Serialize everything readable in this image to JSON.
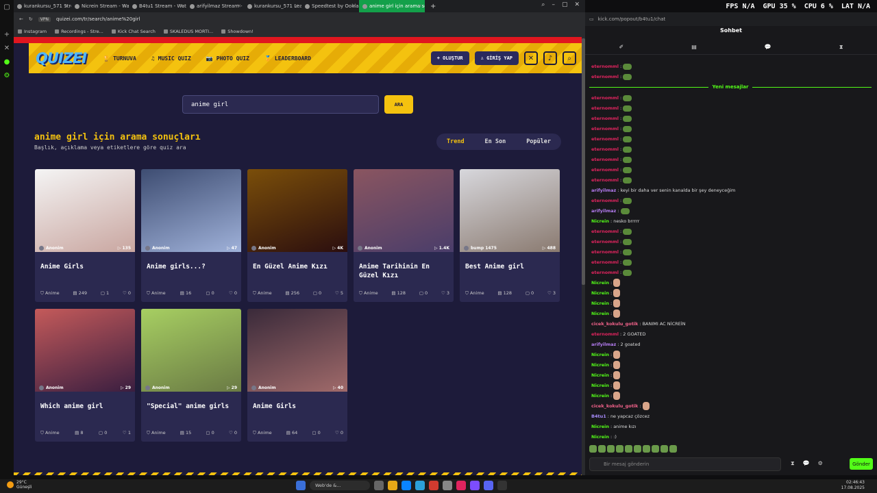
{
  "browser": {
    "tabs": [
      {
        "title": "kurankursu_571 Strea"
      },
      {
        "title": "Nicrein Stream - Watch L"
      },
      {
        "title": "B4tu1 Stream - Watch Liv"
      },
      {
        "title": "arifyilmaz Stream - Watc"
      },
      {
        "title": "kurankursu_571 Leaderb"
      },
      {
        "title": "Speedtest by Ookla - The"
      },
      {
        "title": "anime girl için arama son"
      }
    ],
    "new_tab": "+",
    "url_badge": "VPN",
    "url": "quizei.com/tr/search/anime%20girl",
    "bookmarks": [
      "Instagram",
      "Recordings - Stre...",
      "Kick Chat Search",
      "SKALEDUS MORTI...",
      "Showdown!"
    ]
  },
  "site": {
    "logo": "QUIZEI",
    "nav": [
      {
        "icon": "trophy-icon",
        "glyph": "🏆",
        "label": "TURNUVA"
      },
      {
        "icon": "music-note-icon",
        "glyph": "♫",
        "label": "MUSIC QUIZ"
      },
      {
        "icon": "camera-icon",
        "glyph": "📷",
        "label": "PHOTO QUIZ"
      },
      {
        "icon": "leaderboard-icon",
        "glyph": "🏅",
        "label": "LEADERBOARD"
      }
    ],
    "create_label": "+ OLUŞTUR",
    "login_label": "♙ GİRİŞ YAP",
    "search": {
      "value": "anime girl",
      "button": "ARA"
    },
    "results_title": "anime girl için arama sonuçları",
    "results_subtitle": "Başlık, açıklama veya etiketlere göre quiz ara",
    "sort_tabs": [
      {
        "label": "Trend",
        "active": true
      },
      {
        "label": "En Son"
      },
      {
        "label": "Popüler"
      }
    ],
    "cards": [
      {
        "author": "Anonim",
        "plays": "▷ 135",
        "title": "Anime Girls",
        "category": "Anime",
        "items": "249",
        "comments": "1",
        "likes": "0",
        "thumb_colors": [
          "#f4f4f4",
          "#c9a6a0"
        ]
      },
      {
        "author": "Anonim",
        "plays": "▷ 47",
        "title": "Anime girls...?",
        "category": "Anime",
        "items": "16",
        "comments": "0",
        "likes": "0",
        "thumb_colors": [
          "#3e4d72",
          "#9fb1d9"
        ]
      },
      {
        "author": "Anonim",
        "plays": "▷ 4K",
        "title": "En Güzel Anime Kızı",
        "category": "Anime",
        "items": "256",
        "comments": "0",
        "likes": "5",
        "thumb_colors": [
          "#7a4e0a",
          "#2b0e0e"
        ]
      },
      {
        "author": "Anonim",
        "plays": "▷ 1.4K",
        "title": "Anime Tarihinin En Güzel Kızı",
        "category": "Anime",
        "items": "128",
        "comments": "0",
        "likes": "3",
        "thumb_colors": [
          "#8a5560",
          "#4a3d6a"
        ]
      },
      {
        "author": "bump 1475",
        "plays": "▷ 488",
        "title": "Best Anime girl",
        "category": "Anime",
        "items": "128",
        "comments": "0",
        "likes": "3",
        "thumb_colors": [
          "#d7d7dc",
          "#8a7a70"
        ]
      },
      {
        "author": "Anonim",
        "plays": "▷ 29",
        "title": "Which anime girl",
        "category": "Anime",
        "items": "8",
        "comments": "0",
        "likes": "1",
        "thumb_colors": [
          "#c45a5a",
          "#3a1e40"
        ]
      },
      {
        "author": "Anonim",
        "plays": "▷ 29",
        "title": "\"Special\" anime girls",
        "category": "Anime",
        "items": "15",
        "comments": "0",
        "likes": "0",
        "thumb_colors": [
          "#a7cf62",
          "#6a7a44"
        ]
      },
      {
        "author": "Anonim",
        "plays": "▷ 40",
        "title": "Anime Girls",
        "category": "Anime",
        "items": "64",
        "comments": "0",
        "likes": "0",
        "thumb_colors": [
          "#3a2a3a",
          "#a06a6a"
        ]
      }
    ]
  },
  "stats": {
    "fps_label": "FPS",
    "fps": "N/A",
    "gpu_label": "GPU",
    "gpu": "35 %",
    "cpu_label": "CPU",
    "cpu": "6 %",
    "lat_label": "LAT",
    "lat": "N/A"
  },
  "chat": {
    "url": "kick.com/popout/b4tu1/chat",
    "title": "Sohbet",
    "tabs": [
      "✐",
      "▤",
      "💬",
      "⧗"
    ],
    "new_messages": "Yeni mesajlar",
    "messages": [
      {
        "user": "eternomml",
        "color": "#e0245e",
        "text": "",
        "emote": "e"
      },
      {
        "user": "eternomml",
        "color": "#e0245e",
        "text": "",
        "emote": "e"
      },
      {
        "user": "eternomml",
        "color": "#e0245e",
        "text": "",
        "emote": "e"
      },
      {
        "user": "eternomml",
        "color": "#e0245e",
        "text": "",
        "emote": "e"
      },
      {
        "user": "eternomml",
        "color": "#e0245e",
        "text": "",
        "emote": "e"
      },
      {
        "user": "eternomml",
        "color": "#e0245e",
        "text": "",
        "emote": "e"
      },
      {
        "user": "eternomml",
        "color": "#e0245e",
        "text": "",
        "emote": "e"
      },
      {
        "user": "eternomml",
        "color": "#e0245e",
        "text": "",
        "emote": "e"
      },
      {
        "user": "eternomml",
        "color": "#e0245e",
        "text": "",
        "emote": "e"
      },
      {
        "user": "eternomml",
        "color": "#e0245e",
        "text": "",
        "emote": "e"
      },
      {
        "user": "eternomml",
        "color": "#e0245e",
        "text": "",
        "emote": "e"
      },
      {
        "user": "arifyilmaz",
        "color": "#b57cf2",
        "text": "keyi bir daha ver senin kanalda bir şey deneyceğim",
        "emote": ""
      },
      {
        "user": "eternomml",
        "color": "#e0245e",
        "text": "",
        "emote": "e"
      },
      {
        "user": "arifyilmaz",
        "color": "#b57cf2",
        "text": "",
        "emote": "e"
      },
      {
        "user": "Nicrein",
        "color": "#53fc18",
        "text": "nesko brrrrr",
        "emote": ""
      },
      {
        "user": "eternomml",
        "color": "#e0245e",
        "text": "",
        "emote": "e"
      },
      {
        "user": "eternomml",
        "color": "#e0245e",
        "text": "",
        "emote": "e"
      },
      {
        "user": "eternomml",
        "color": "#e0245e",
        "text": "",
        "emote": "e"
      },
      {
        "user": "eternomml",
        "color": "#e0245e",
        "text": "",
        "emote": "e"
      },
      {
        "user": "eternomml",
        "color": "#e0245e",
        "text": "",
        "emote": "e"
      },
      {
        "user": "Nicrein",
        "color": "#53fc18",
        "text": "",
        "emote": "k"
      },
      {
        "user": "Nicrein",
        "color": "#53fc18",
        "text": "",
        "emote": "k"
      },
      {
        "user": "Nicrein",
        "color": "#53fc18",
        "text": "",
        "emote": "k"
      },
      {
        "user": "Nicrein",
        "color": "#53fc18",
        "text": "",
        "emote": "k"
      },
      {
        "user": "cicek_kokulu_gotik",
        "color": "#f2628a",
        "text": "BANIMI AC NİCREİN",
        "emote": ""
      },
      {
        "user": "eternomml",
        "color": "#e0245e",
        "text": "2 GOATED",
        "emote": ""
      },
      {
        "user": "arifyilmaz",
        "color": "#b57cf2",
        "text": "2 goated",
        "emote": ""
      },
      {
        "user": "Nicrein",
        "color": "#53fc18",
        "text": "",
        "emote": "k"
      },
      {
        "user": "Nicrein",
        "color": "#53fc18",
        "text": "",
        "emote": "k"
      },
      {
        "user": "Nicrein",
        "color": "#53fc18",
        "text": "",
        "emote": "k"
      },
      {
        "user": "Nicrein",
        "color": "#53fc18",
        "text": "",
        "emote": "k"
      },
      {
        "user": "Nicrein",
        "color": "#53fc18",
        "text": "",
        "emote": "k"
      },
      {
        "user": "cicek_kokulu_gotik",
        "color": "#f2628a",
        "text": "",
        "emote": "k"
      },
      {
        "user": "B4tu1",
        "color": "#a78bfa",
        "text": "ne yapcaz çözcez",
        "emote": ""
      },
      {
        "user": "Nicrein",
        "color": "#53fc18",
        "text": "anime kızı",
        "emote": ""
      },
      {
        "user": "Nicrein",
        "color": "#53fc18",
        "text": ":)",
        "emote": ""
      }
    ],
    "input_placeholder": "Bir mesaj gönderin",
    "send_label": "Gönder"
  },
  "taskbar": {
    "temp": "29°C",
    "weather": "Güneşli",
    "search": "Web'de &...",
    "time": "02:46:43",
    "date": "17.08.2025"
  }
}
